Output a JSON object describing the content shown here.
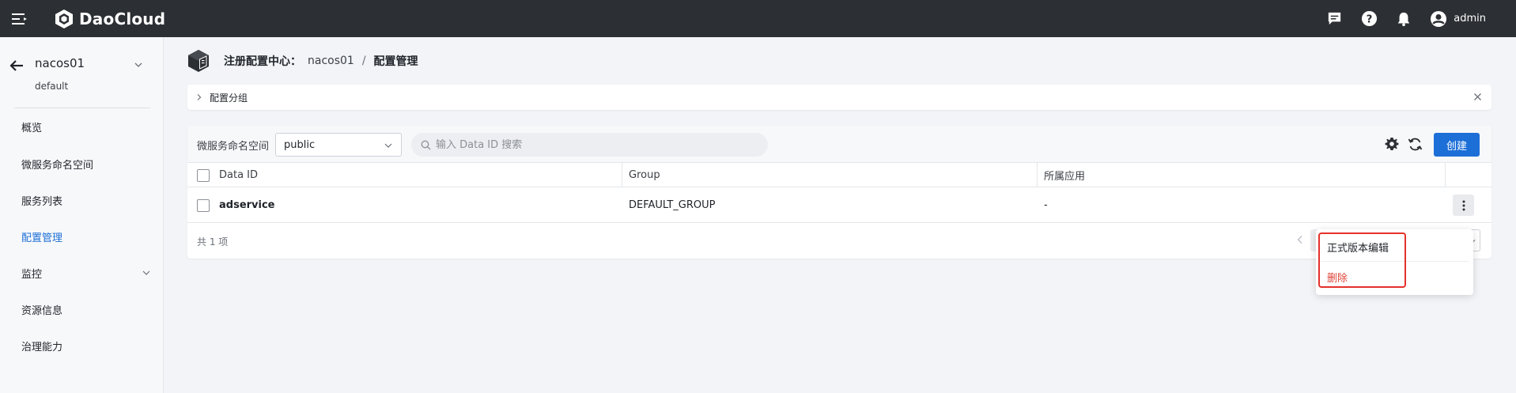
{
  "topbar": {
    "brand": "DaoCloud",
    "username": "admin"
  },
  "sidebar": {
    "namespace": "nacos01",
    "namespace_sub": "default",
    "items": [
      {
        "label": "概览",
        "active": false
      },
      {
        "label": "微服务命名空间",
        "active": false
      },
      {
        "label": "服务列表",
        "active": false
      },
      {
        "label": "配置管理",
        "active": true
      },
      {
        "label": "监控",
        "active": false,
        "expandable": true
      },
      {
        "label": "资源信息",
        "active": false
      },
      {
        "label": "治理能力",
        "active": false
      }
    ]
  },
  "breadcrumb": {
    "title": "注册配置中心：",
    "instance": "nacos01",
    "separator": "/",
    "current": "配置管理"
  },
  "config_group": {
    "label": "配置分组"
  },
  "toolbar": {
    "namespace_label": "微服务命名空间",
    "namespace_value": "public",
    "search_placeholder": "输入 Data ID 搜索",
    "create_label": "创建"
  },
  "table": {
    "headers": [
      "Data ID",
      "Group",
      "所属应用"
    ],
    "rows": [
      {
        "data_id": "adservice",
        "group": "DEFAULT_GROUP",
        "app": "-"
      }
    ],
    "total": "共 1 项"
  },
  "row_menu": {
    "items": [
      "正式版本编辑",
      "删除"
    ]
  },
  "colors": {
    "primary": "#1d6fd8",
    "danger": "#e0453a",
    "topbar": "#2c2f33",
    "highlight": "#e5312b"
  }
}
